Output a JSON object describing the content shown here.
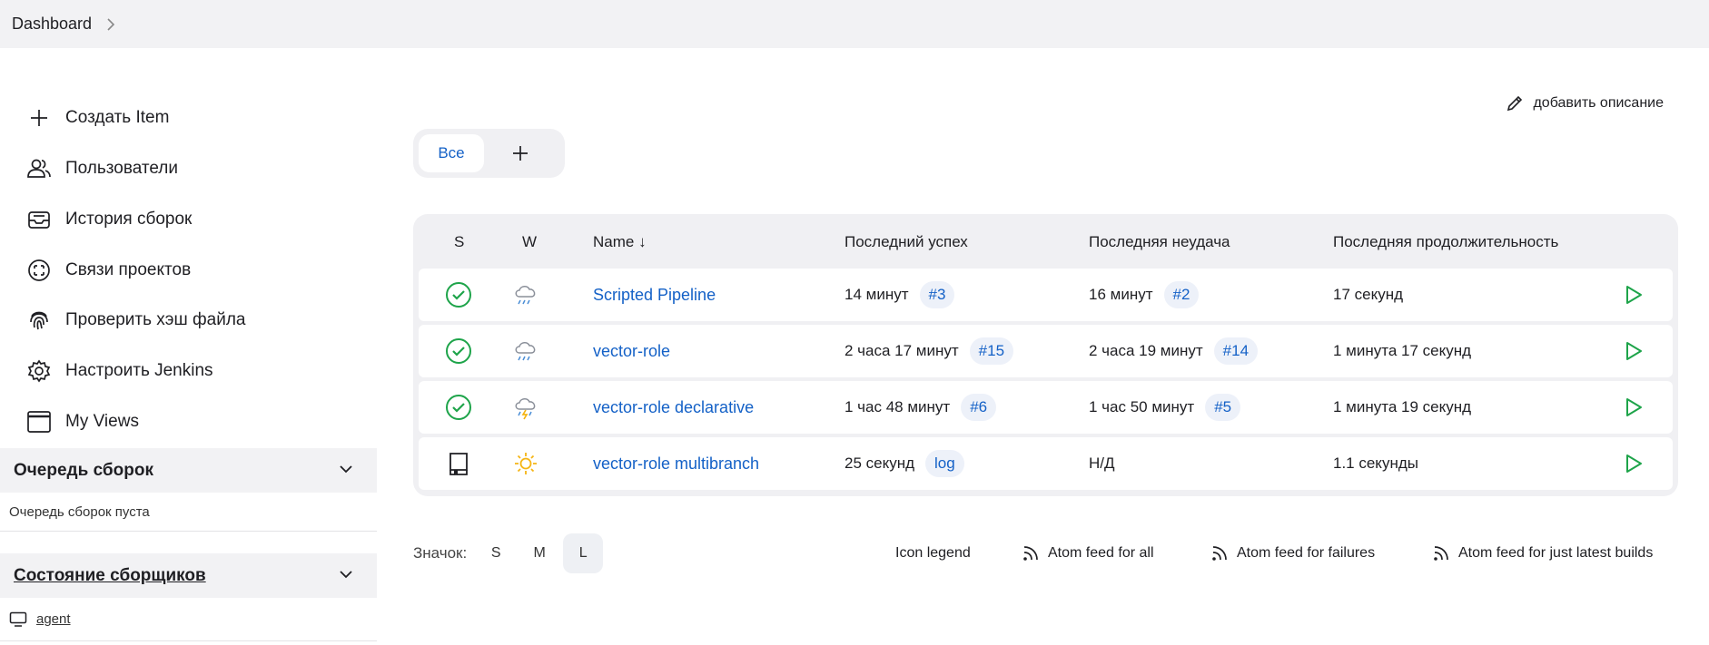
{
  "breadcrumb": {
    "dashboard": "Dashboard"
  },
  "sidebar": {
    "tasks": [
      {
        "label": "Создать Item",
        "icon": "plus-icon"
      },
      {
        "label": "Пользователи",
        "icon": "users-icon"
      },
      {
        "label": "История сборок",
        "icon": "inbox-icon"
      },
      {
        "label": "Связи проектов",
        "icon": "relationships-icon"
      },
      {
        "label": "Проверить хэш файла",
        "icon": "fingerprint-icon"
      },
      {
        "label": "Настроить Jenkins",
        "icon": "gear-icon"
      },
      {
        "label": "My Views",
        "icon": "window-icon"
      }
    ],
    "queue": {
      "title": "Очередь сборок",
      "empty_text": "Очередь сборок пуста"
    },
    "executors": {
      "title": "Состояние сборщиков",
      "agent": "agent"
    }
  },
  "main": {
    "add_description": "добавить описание",
    "tabs": {
      "all": "Все"
    },
    "table": {
      "headers": {
        "s": "S",
        "w": "W",
        "name": "Name ↓",
        "last_success": "Последний успех",
        "last_failure": "Последняя неудача",
        "last_duration": "Последняя продолжительность"
      },
      "rows": [
        {
          "status": "success",
          "weather": "rain",
          "name": "Scripted Pipeline",
          "last_success": "14 минут",
          "last_success_build": "#3",
          "last_failure": "16 минут",
          "last_failure_build": "#2",
          "duration": "17 секунд"
        },
        {
          "status": "success",
          "weather": "rain",
          "name": "vector-role",
          "last_success": "2 часа 17 минут",
          "last_success_build": "#15",
          "last_failure": "2 часа 19 минут",
          "last_failure_build": "#14",
          "duration": "1 минута 17 секунд"
        },
        {
          "status": "success",
          "weather": "storm",
          "name": "vector-role declarative",
          "last_success": "1 час 48 минут",
          "last_success_build": "#6",
          "last_failure": "1 час 50 минут",
          "last_failure_build": "#5",
          "duration": "1 минута 19 секунд"
        },
        {
          "status": "multibranch",
          "weather": "sunny",
          "name": "vector-role multibranch",
          "last_success": "25 секунд",
          "last_success_build": "log",
          "last_failure": "Н/Д",
          "last_failure_build": "",
          "duration": "1.1 секунды"
        }
      ]
    },
    "footer": {
      "icon_label": "Значок:",
      "sizes": [
        "S",
        "M",
        "L"
      ],
      "selected_size": "L",
      "icon_legend": "Icon legend",
      "feed_all": "Atom feed for all",
      "feed_failures": "Atom feed for failures",
      "feed_latest": "Atom feed for just latest builds"
    }
  },
  "colors": {
    "accent_link": "#1461c7",
    "success": "#1ea44a",
    "weather_sun": "#f5b515",
    "weather_rain": "#4c8fd6",
    "panel_bg": "#f0f0f3"
  }
}
